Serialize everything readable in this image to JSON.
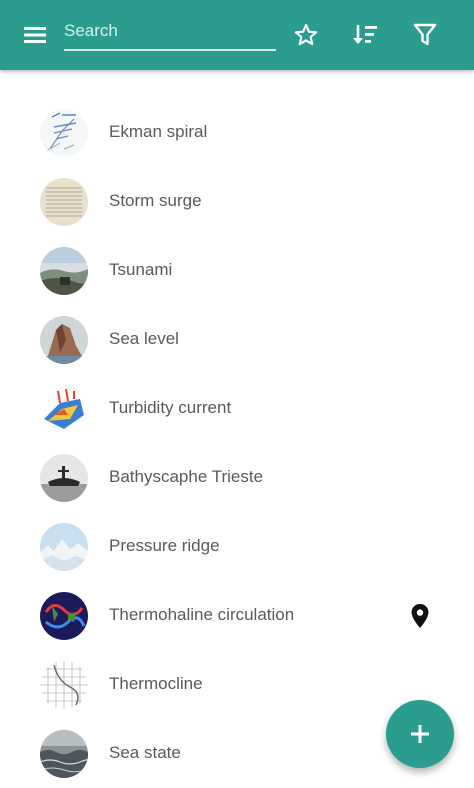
{
  "toolbar": {
    "background": "#2a9d8f",
    "menu_icon": "hamburger-menu-icon",
    "search": {
      "placeholder": "Search",
      "value": ""
    },
    "actions": [
      {
        "icon": "star-outline-icon"
      },
      {
        "icon": "sort-icon"
      },
      {
        "icon": "filter-icon"
      }
    ]
  },
  "list": {
    "items": [
      {
        "label": "Ekman spiral"
      },
      {
        "label": "Storm surge"
      },
      {
        "label": "Tsunami"
      },
      {
        "label": "Sea level"
      },
      {
        "label": "Turbidity current"
      },
      {
        "label": "Bathyscaphe Trieste"
      },
      {
        "label": "Pressure ridge"
      },
      {
        "label": "Thermohaline circulation",
        "badge_icon": "location-pin-icon"
      },
      {
        "label": "Thermocline"
      },
      {
        "label": "Sea state"
      }
    ]
  },
  "fab": {
    "icon": "plus-icon",
    "color": "#2a9d8f"
  }
}
